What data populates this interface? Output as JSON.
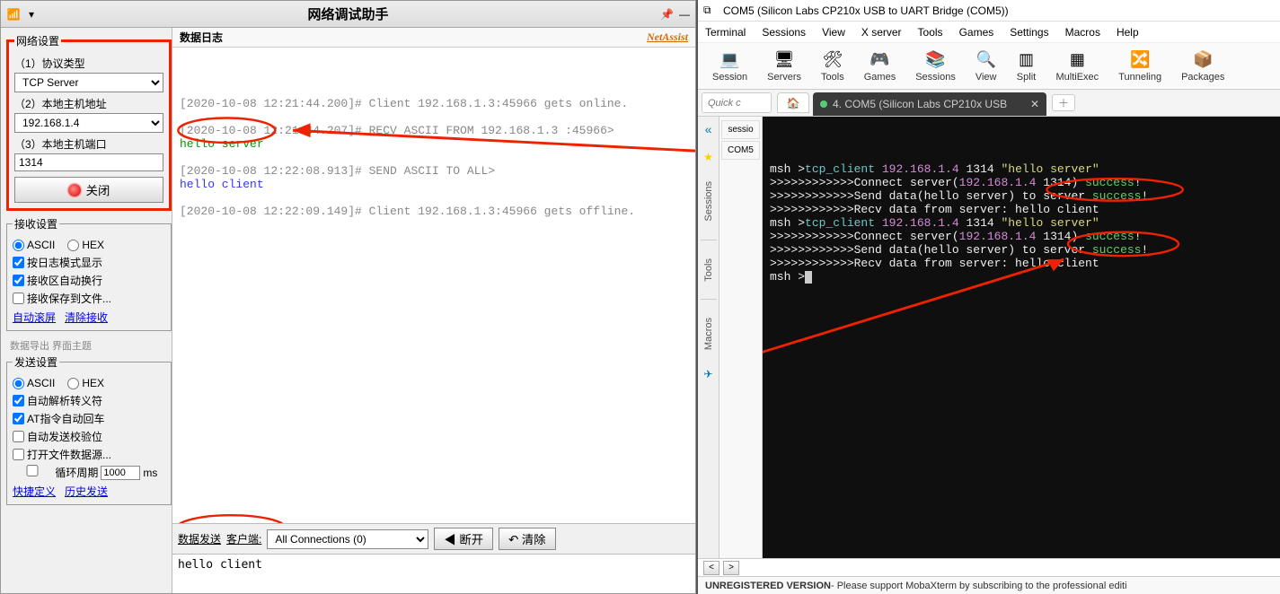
{
  "netassist": {
    "window_title": "网络调试助手",
    "brand": "NetAssist",
    "sections": {
      "net": {
        "legend": "网络设置",
        "protocol_label": "（1）协议类型",
        "protocol_value": "TCP Server",
        "host_label": "（2）本地主机地址",
        "host_value": "192.168.1.4",
        "port_label": "（3）本地主机端口",
        "port_value": "1314",
        "close_btn": "关闭"
      },
      "recv": {
        "legend": "接收设置",
        "ascii": "ASCII",
        "hex": "HEX",
        "opt_log": "按日志模式显示",
        "opt_wrap": "接收区自动换行",
        "opt_save": "接收保存到文件...",
        "link_scroll": "自动滚屏",
        "link_clear": "清除接收"
      },
      "export_stub": "数据导出  界面主题",
      "send": {
        "legend": "发送设置",
        "ascii": "ASCII",
        "hex": "HEX",
        "opt_escape": "自动解析转义符",
        "opt_at": "AT指令自动回车",
        "opt_chk": "自动发送校验位",
        "opt_file": "打开文件数据源...",
        "cycle_label": "循环周期",
        "cycle_value": "1000",
        "cycle_unit": "ms",
        "link_shortcut": "快捷定义",
        "link_history": "历史发送"
      }
    },
    "log": {
      "title": "数据日志",
      "lines": [
        {
          "text": "[2020-10-08 12:21:44.200]# Client 192.168.1.3:45966 gets online.",
          "cls": "l-gray"
        },
        {
          "text": "",
          "cls": ""
        },
        {
          "text": "[2020-10-08 12:21:44.207]# RECV ASCII FROM 192.168.1.3 :45966>",
          "cls": "l-gray"
        },
        {
          "text": "hello server",
          "cls": "l-green"
        },
        {
          "text": "",
          "cls": ""
        },
        {
          "text": "[2020-10-08 12:22:08.913]# SEND ASCII TO ALL>",
          "cls": "l-gray"
        },
        {
          "text": "hello client",
          "cls": "l-blue"
        },
        {
          "text": "",
          "cls": ""
        },
        {
          "text": "[2020-10-08 12:22:09.149]# Client 192.168.1.3:45966 gets offline.",
          "cls": "l-gray"
        }
      ]
    },
    "sendbar": {
      "label": "数据发送",
      "client_label": "客户端:",
      "conn_select": "All Connections (0)",
      "disconnect": "◀ 断开",
      "clear": "↶ 清除",
      "input_value": "hello client"
    }
  },
  "moba": {
    "window_title": "COM5  (Silicon Labs CP210x USB to UART Bridge (COM5))",
    "menus": [
      "Terminal",
      "Sessions",
      "View",
      "X server",
      "Tools",
      "Games",
      "Settings",
      "Macros",
      "Help"
    ],
    "toolbar": [
      {
        "label": "Session",
        "icon": "💻"
      },
      {
        "label": "Servers",
        "icon": "🖥"
      },
      {
        "label": "Tools",
        "icon": "🛠"
      },
      {
        "label": "Games",
        "icon": "🎮"
      },
      {
        "label": "Sessions",
        "icon": "📚"
      },
      {
        "label": "View",
        "icon": "🔍"
      },
      {
        "label": "Split",
        "icon": "▥"
      },
      {
        "label": "MultiExec",
        "icon": "▦"
      },
      {
        "label": "Tunneling",
        "icon": "🔀"
      },
      {
        "label": "Packages",
        "icon": "📦"
      }
    ],
    "quick_placeholder": "Quick c",
    "active_tab": "4. COM5  (Silicon Labs CP210x USB",
    "side_tabs": [
      "Sessions",
      "Tools",
      "Macros"
    ],
    "session_items": [
      "sessio",
      "COM5"
    ],
    "terminal_lines": [
      [
        {
          "t": "msh >",
          "c": ""
        },
        {
          "t": "tcp_client ",
          "c": "t-cyan"
        },
        {
          "t": "192.168.1.4",
          "c": "t-purple"
        },
        {
          "t": " 1314 ",
          "c": ""
        },
        {
          "t": "\"hello server\"",
          "c": "t-yellow"
        }
      ],
      [
        {
          "t": ">>>>>>>>>>>>Connect server(",
          "c": ""
        },
        {
          "t": "192.168.1.4",
          "c": "t-purple"
        },
        {
          "t": " 1314) ",
          "c": ""
        },
        {
          "t": "success",
          "c": "t-green"
        },
        {
          "t": "!",
          "c": ""
        }
      ],
      [
        {
          "t": ">>>>>>>>>>>>Send data(hello server) to server ",
          "c": ""
        },
        {
          "t": "success",
          "c": "t-green"
        },
        {
          "t": "!",
          "c": ""
        }
      ],
      [
        {
          "t": ">>>>>>>>>>>>Recv data from server: hello client",
          "c": ""
        }
      ],
      [
        {
          "t": "msh >",
          "c": ""
        },
        {
          "t": "tcp_client ",
          "c": "t-cyan"
        },
        {
          "t": "192.168.1.4",
          "c": "t-purple"
        },
        {
          "t": " 1314 ",
          "c": ""
        },
        {
          "t": "\"hello server\"",
          "c": "t-yellow"
        }
      ],
      [
        {
          "t": ">>>>>>>>>>>>Connect server(",
          "c": ""
        },
        {
          "t": "192.168.1.4",
          "c": "t-purple"
        },
        {
          "t": " 1314) ",
          "c": ""
        },
        {
          "t": "success",
          "c": "t-green"
        },
        {
          "t": "!",
          "c": ""
        }
      ],
      [
        {
          "t": ">>>>>>>>>>>>Send data(hello server) to server ",
          "c": ""
        },
        {
          "t": "success",
          "c": "t-green"
        },
        {
          "t": "!",
          "c": ""
        }
      ],
      [
        {
          "t": ">>>>>>>>>>>>Recv data from server: hello client",
          "c": ""
        }
      ],
      [
        {
          "t": "msh >",
          "c": ""
        }
      ]
    ],
    "footer_bold": "UNREGISTERED VERSION",
    "footer_rest": " - Please support MobaXterm by subscribing to the professional editi"
  }
}
